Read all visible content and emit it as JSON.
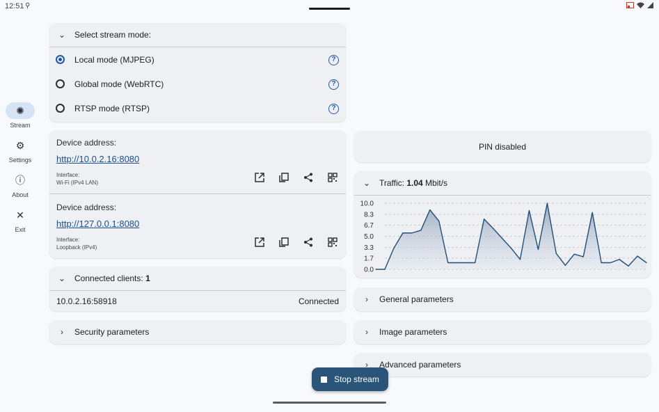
{
  "status": {
    "time": "12:51"
  },
  "rail": {
    "items": [
      {
        "label": "Stream",
        "icon": "stream-icon"
      },
      {
        "label": "Settings",
        "icon": "gear-icon"
      },
      {
        "label": "About",
        "icon": "info-icon"
      },
      {
        "label": "Exit",
        "icon": "close-icon"
      }
    ]
  },
  "mode": {
    "header": "Select stream mode:",
    "options": [
      {
        "label": "Local mode (MJPEG)",
        "selected": true
      },
      {
        "label": "Global mode (WebRTC)",
        "selected": false
      },
      {
        "label": "RTSP mode (RTSP)",
        "selected": false
      }
    ]
  },
  "addresses": [
    {
      "label": "Device address:",
      "url": "http://10.0.2.16:8080",
      "iface_label": "Interface:",
      "iface": "Wi-Fi (IPv4 LAN)"
    },
    {
      "label": "Device address:",
      "url": "http://127.0.0.1:8080",
      "iface_label": "Interface:",
      "iface": "Loopback (IPv4)"
    }
  ],
  "clients": {
    "header": "Connected clients: ",
    "count": "1",
    "rows": [
      {
        "address": "10.0.2.16:58918",
        "status": "Connected"
      }
    ]
  },
  "security": {
    "label": "Security parameters"
  },
  "pin": {
    "label": "PIN disabled"
  },
  "traffic": {
    "label": "Traffic: ",
    "value": "1.04",
    "unit": "Mbit/s"
  },
  "params": {
    "general": "General parameters",
    "image": "Image parameters",
    "advanced": "Advanced parameters"
  },
  "stop_button": {
    "label": "Stop stream"
  },
  "colors": {
    "accent": "#1b5aa6",
    "button": "#2a5478",
    "card": "#eef0f4",
    "chart_line": "#1f4e79"
  },
  "chart_data": {
    "type": "area",
    "title": "",
    "xlabel": "",
    "ylabel": "",
    "ylim": [
      0,
      10
    ],
    "yticks": [
      "10.0",
      "8.3",
      "6.7",
      "5.0",
      "3.3",
      "1.7",
      "0.0"
    ],
    "grid": true,
    "series": [
      {
        "values": [
          0.0,
          0.0,
          3.2,
          5.5,
          5.5,
          5.9,
          9.0,
          7.3,
          1.0,
          1.0,
          1.0,
          1.0,
          7.6,
          6.2,
          4.7,
          3.2,
          1.5,
          8.9,
          3.0,
          10.0,
          2.4,
          0.6,
          2.3,
          1.9,
          8.6,
          1.0,
          1.0,
          1.5,
          0.5,
          2.0,
          1.0
        ]
      }
    ]
  }
}
